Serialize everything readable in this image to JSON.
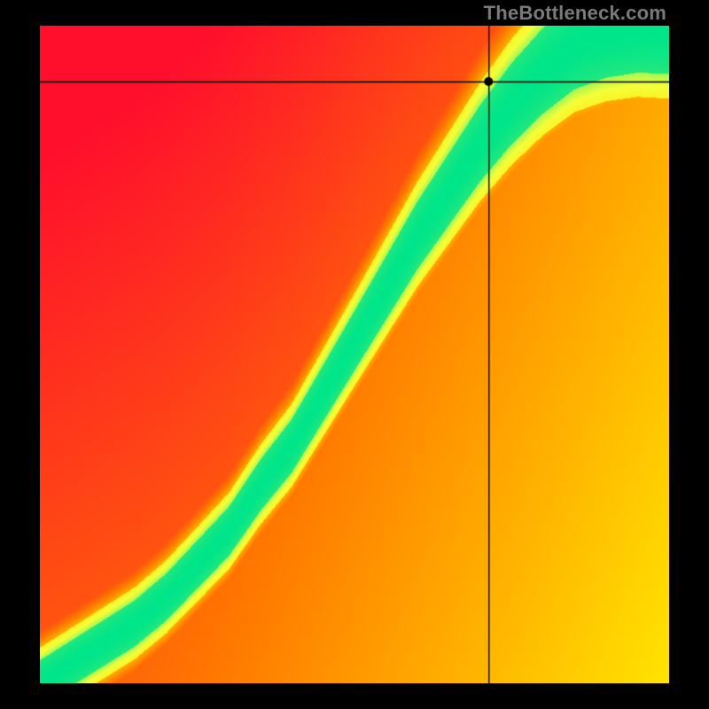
{
  "watermark": "TheBottleneck.com",
  "chart_data": {
    "type": "heatmap",
    "title": "",
    "xlabel": "",
    "ylabel": "",
    "x_range": [
      0,
      100
    ],
    "y_range": [
      0,
      100
    ],
    "grid": false,
    "crosshair": {
      "x": 71.4,
      "y": 91.5
    },
    "marker": {
      "x": 71.4,
      "y": 91.5
    },
    "colorscale": [
      {
        "t": 0.0,
        "hex": "#ff0033"
      },
      {
        "t": 0.4,
        "hex": "#ff7a00"
      },
      {
        "t": 0.7,
        "hex": "#ffe400"
      },
      {
        "t": 0.85,
        "hex": "#f5ff3a"
      },
      {
        "t": 1.0,
        "hex": "#00e58a"
      }
    ],
    "optimal_curve": {
      "description": "green ridge roughly tracing y = 100*(x/100)^1.6 with slight S-bend near origin",
      "points": [
        {
          "x": 0,
          "y": 0
        },
        {
          "x": 5,
          "y": 3
        },
        {
          "x": 10,
          "y": 6
        },
        {
          "x": 15,
          "y": 9
        },
        {
          "x": 20,
          "y": 13
        },
        {
          "x": 25,
          "y": 18
        },
        {
          "x": 30,
          "y": 23
        },
        {
          "x": 35,
          "y": 30
        },
        {
          "x": 40,
          "y": 36
        },
        {
          "x": 45,
          "y": 44
        },
        {
          "x": 50,
          "y": 52
        },
        {
          "x": 55,
          "y": 60
        },
        {
          "x": 60,
          "y": 68
        },
        {
          "x": 65,
          "y": 75
        },
        {
          "x": 70,
          "y": 82
        },
        {
          "x": 75,
          "y": 88
        },
        {
          "x": 80,
          "y": 93
        },
        {
          "x": 85,
          "y": 97
        },
        {
          "x": 90,
          "y": 99
        },
        {
          "x": 95,
          "y": 100
        },
        {
          "x": 100,
          "y": 100
        }
      ],
      "band_width_percent": 6.0
    }
  }
}
